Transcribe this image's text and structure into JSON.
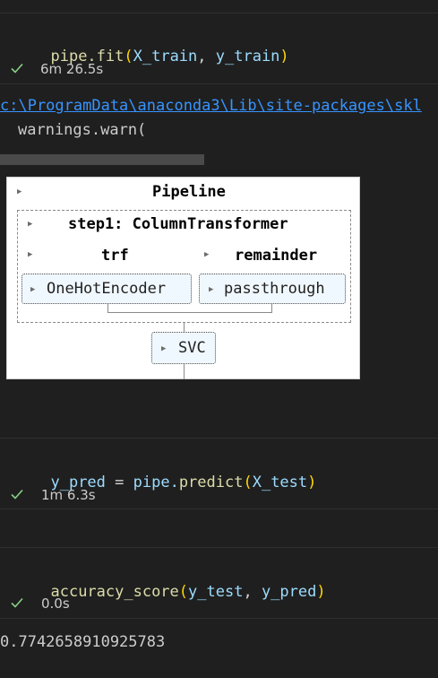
{
  "cells": [
    {
      "code": {
        "fn": "pipe.fit",
        "open": "(",
        "a1": "X_train",
        "sep": ", ",
        "a2": "y_train",
        "close": ")"
      },
      "time": "6m 26.5s"
    },
    {
      "code": {
        "lhs": "y_pred",
        "eq": " = ",
        "fn_obj": "pipe.",
        "fn": "predict",
        "open": "(",
        "a1": "X_test",
        "close": ")"
      },
      "time": "1m 6.3s"
    },
    {
      "code": {
        "fn": "accuracy_score",
        "open": "(",
        "a1": "y_test",
        "sep": ", ",
        "a2": "y_pred",
        "close": ")"
      },
      "time": "0.0s"
    }
  ],
  "warning": {
    "path": "c:\\ProgramData\\anaconda3\\Lib\\site-packages\\skl",
    "call": "warnings.warn("
  },
  "pipeline": {
    "title": "Pipeline",
    "step1": "step1: ColumnTransformer",
    "trf": "trf",
    "remainder": "remainder",
    "encoder": "OneHotEncoder",
    "passthrough": "passthrough",
    "svc": "SVC"
  },
  "result": "0.7742658910925783",
  "colors": {
    "background": "#1f1f1f",
    "success": "#89d185",
    "link": "#3794ff",
    "estimator_bg": "#f0f8ff"
  }
}
